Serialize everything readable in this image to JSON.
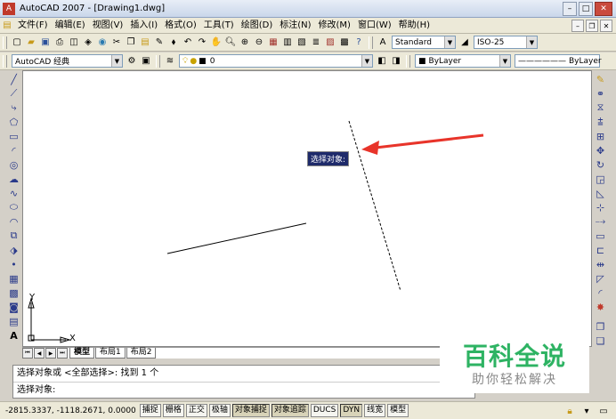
{
  "titlebar": {
    "app_title": "AutoCAD 2007 - [Drawing1.dwg]",
    "min": "–",
    "max": "□",
    "close": "✕"
  },
  "menu": {
    "items": [
      "文件(F)",
      "编辑(E)",
      "视图(V)",
      "插入(I)",
      "格式(O)",
      "工具(T)",
      "绘图(D)",
      "标注(N)",
      "修改(M)",
      "窗口(W)",
      "帮助(H)"
    ]
  },
  "toolbar1": {
    "text_style": "Standard",
    "dim_style": "ISO-25"
  },
  "toolbar2": {
    "workspace": "AutoCAD 经典",
    "layer": "0",
    "color": "ByLayer",
    "linetype": "ByLayer"
  },
  "canvas": {
    "tooltip": "选择对象:",
    "ucs_x": "X",
    "ucs_y": "Y",
    "arrow_color": "#e8342a"
  },
  "tabs": [
    "模型",
    "布局1",
    "布局2"
  ],
  "command": {
    "line1": "选择对象或 <全部选择>:  找到 1 个",
    "line2": "选择对象:"
  },
  "status": {
    "coords": "-2815.3337, -1118.2671, 0.0000",
    "buttons": [
      "捕捉",
      "栅格",
      "正交",
      "极轴",
      "对象捕捉",
      "对象追踪",
      "DUCS",
      "DYN",
      "线宽",
      "模型"
    ]
  },
  "watermark": {
    "main": "百科全说",
    "sub": "助你轻松解决",
    "color": "#2eb363"
  }
}
